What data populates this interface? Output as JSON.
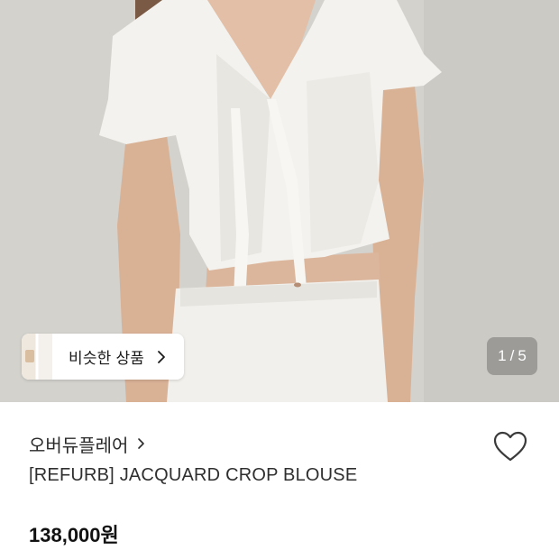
{
  "photo": {
    "description_icon": "product-photo",
    "counter": {
      "current": "1",
      "separator": "/",
      "total": "5"
    }
  },
  "similar_products": {
    "label": "비슷한 상품",
    "icon": "chevron-right-icon"
  },
  "product": {
    "brand": "오버듀플레어",
    "name": "[REFURB] JACQUARD CROP BLOUSE",
    "price": "138,000원",
    "wishlist_icon": "heart-outline-icon"
  },
  "colors": {
    "text_primary": "#111111",
    "background": "#ffffff"
  }
}
